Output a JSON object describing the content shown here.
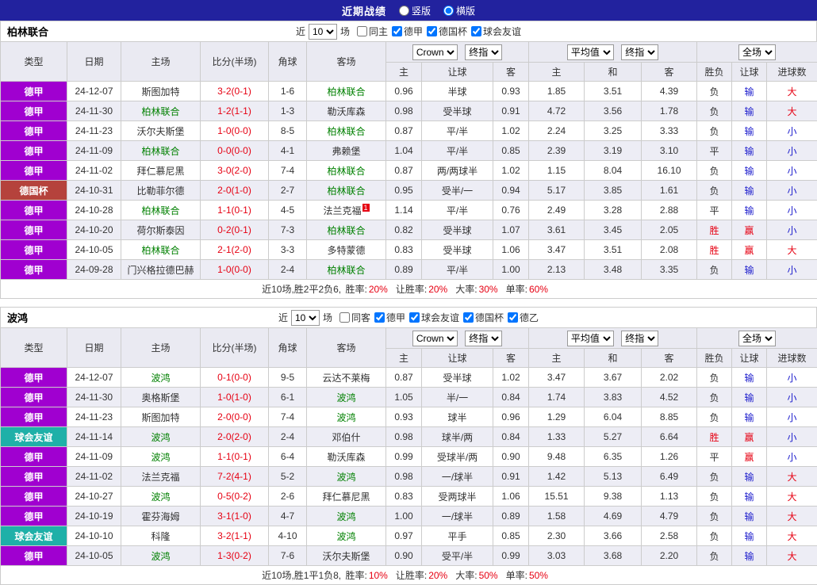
{
  "titlebar": {
    "title": "近期战绩",
    "options": [
      {
        "label": "竖版",
        "selected": false
      },
      {
        "label": "横版",
        "selected": true
      }
    ]
  },
  "columns": {
    "type": "类型",
    "date": "日期",
    "home": "主场",
    "score": "比分(半场)",
    "corner": "角球",
    "away": "客场",
    "asia_home": "主",
    "asia_handicap": "让球",
    "asia_away": "客",
    "euro_home": "主",
    "euro_draw": "和",
    "euro_away": "客",
    "result": "胜负",
    "handicap_result": "让球",
    "goals": "进球数"
  },
  "header_dropdowns": {
    "company": "Crown",
    "final1": "终指",
    "average": "平均值",
    "final2": "终指",
    "scope": "全场"
  },
  "league_colors": {
    "德甲": "#a000d0",
    "德国杯": "#b5423c",
    "球会友谊": "#1fb0a8"
  },
  "value_colors": {
    "胜": "#e60012",
    "平": "#333333",
    "负": "#333333",
    "赢": "#e60012",
    "输": "#1a1acc",
    "大": "#e60012",
    "小": "#1a1acc"
  },
  "sections": [
    {
      "team": "柏林联合",
      "filter": {
        "near_label": "近",
        "count": "10",
        "games_label": "场",
        "checkboxes": [
          {
            "label": "同主",
            "checked": false
          },
          {
            "label": "德甲",
            "checked": true
          },
          {
            "label": "德国杯",
            "checked": true
          },
          {
            "label": "球会友谊",
            "checked": true
          }
        ]
      },
      "rows": [
        {
          "league": "德甲",
          "date": "24-12-07",
          "home": "斯图加特",
          "score": "3-2(0-1)",
          "corner": "1-6",
          "away": "柏林联合",
          "o1": "0.96",
          "handicap": "半球",
          "o3": "0.93",
          "e1": "1.85",
          "e2": "3.51",
          "e3": "4.39",
          "result": "负",
          "hres": "输",
          "goals": "大"
        },
        {
          "league": "德甲",
          "date": "24-11-30",
          "home": "柏林联合",
          "score": "1-2(1-1)",
          "corner": "1-3",
          "away": "勒沃库森",
          "o1": "0.98",
          "handicap": "受半球",
          "o3": "0.91",
          "e1": "4.72",
          "e2": "3.56",
          "e3": "1.78",
          "result": "负",
          "hres": "输",
          "goals": "大"
        },
        {
          "league": "德甲",
          "date": "24-11-23",
          "home": "沃尔夫斯堡",
          "score": "1-0(0-0)",
          "corner": "8-5",
          "away": "柏林联合",
          "o1": "0.87",
          "handicap": "平/半",
          "o3": "1.02",
          "e1": "2.24",
          "e2": "3.25",
          "e3": "3.33",
          "result": "负",
          "hres": "输",
          "goals": "小"
        },
        {
          "league": "德甲",
          "date": "24-11-09",
          "home": "柏林联合",
          "score": "0-0(0-0)",
          "corner": "4-1",
          "away": "弗赖堡",
          "o1": "1.04",
          "handicap": "平/半",
          "o3": "0.85",
          "e1": "2.39",
          "e2": "3.19",
          "e3": "3.10",
          "result": "平",
          "hres": "输",
          "goals": "小"
        },
        {
          "league": "德甲",
          "date": "24-11-02",
          "home": "拜仁慕尼黑",
          "score": "3-0(2-0)",
          "corner": "7-4",
          "away": "柏林联合",
          "o1": "0.87",
          "handicap": "两/两球半",
          "o3": "1.02",
          "e1": "1.15",
          "e2": "8.04",
          "e3": "16.10",
          "result": "负",
          "hres": "输",
          "goals": "小"
        },
        {
          "league": "德国杯",
          "date": "24-10-31",
          "home": "比勒菲尔德",
          "score": "2-0(1-0)",
          "corner": "2-7",
          "away": "柏林联合",
          "o1": "0.95",
          "handicap": "受半/一",
          "o3": "0.94",
          "e1": "5.17",
          "e2": "3.85",
          "e3": "1.61",
          "result": "负",
          "hres": "输",
          "goals": "小"
        },
        {
          "league": "德甲",
          "date": "24-10-28",
          "home": "柏林联合",
          "score": "1-1(0-1)",
          "corner": "4-5",
          "away": "法兰克福",
          "away_sup": "1",
          "o1": "1.14",
          "handicap": "平/半",
          "o3": "0.76",
          "e1": "2.49",
          "e2": "3.28",
          "e3": "2.88",
          "result": "平",
          "hres": "输",
          "goals": "小"
        },
        {
          "league": "德甲",
          "date": "24-10-20",
          "home": "荷尔斯泰因",
          "score": "0-2(0-1)",
          "corner": "7-3",
          "away": "柏林联合",
          "o1": "0.82",
          "handicap": "受半球",
          "o3": "1.07",
          "e1": "3.61",
          "e2": "3.45",
          "e3": "2.05",
          "result": "胜",
          "hres": "赢",
          "goals": "小"
        },
        {
          "league": "德甲",
          "date": "24-10-05",
          "home": "柏林联合",
          "score": "2-1(2-0)",
          "corner": "3-3",
          "away": "多特蒙德",
          "o1": "0.83",
          "handicap": "受半球",
          "o3": "1.06",
          "e1": "3.47",
          "e2": "3.51",
          "e3": "2.08",
          "result": "胜",
          "hres": "赢",
          "goals": "大"
        },
        {
          "league": "德甲",
          "date": "24-09-28",
          "home": "门兴格拉德巴赫",
          "score": "1-0(0-0)",
          "corner": "2-4",
          "away": "柏林联合",
          "o1": "0.89",
          "handicap": "平/半",
          "o3": "1.00",
          "e1": "2.13",
          "e2": "3.48",
          "e3": "3.35",
          "result": "负",
          "hres": "输",
          "goals": "小"
        }
      ],
      "footer": {
        "prefix": "近10场,胜2平2负6,",
        "stats": [
          {
            "label": "胜率:",
            "value": "20%"
          },
          {
            "label": "让胜率:",
            "value": "20%"
          },
          {
            "label": "大率:",
            "value": "30%"
          },
          {
            "label": "单率:",
            "value": "60%"
          }
        ]
      }
    },
    {
      "team": "波鸿",
      "filter": {
        "near_label": "近",
        "count": "10",
        "games_label": "场",
        "checkboxes": [
          {
            "label": "同客",
            "checked": false
          },
          {
            "label": "德甲",
            "checked": true
          },
          {
            "label": "球会友谊",
            "checked": true
          },
          {
            "label": "德国杯",
            "checked": true
          },
          {
            "label": "德乙",
            "checked": true
          }
        ]
      },
      "rows": [
        {
          "league": "德甲",
          "date": "24-12-07",
          "home": "波鸿",
          "score": "0-1(0-0)",
          "corner": "9-5",
          "away": "云达不莱梅",
          "o1": "0.87",
          "handicap": "受半球",
          "o3": "1.02",
          "e1": "3.47",
          "e2": "3.67",
          "e3": "2.02",
          "result": "负",
          "hres": "输",
          "goals": "小"
        },
        {
          "league": "德甲",
          "date": "24-11-30",
          "home": "奥格斯堡",
          "score": "1-0(1-0)",
          "corner": "6-1",
          "away": "波鸿",
          "o1": "1.05",
          "handicap": "半/一",
          "o3": "0.84",
          "e1": "1.74",
          "e2": "3.83",
          "e3": "4.52",
          "result": "负",
          "hres": "输",
          "goals": "小"
        },
        {
          "league": "德甲",
          "date": "24-11-23",
          "home": "斯图加特",
          "score": "2-0(0-0)",
          "corner": "7-4",
          "away": "波鸿",
          "o1": "0.93",
          "handicap": "球半",
          "o3": "0.96",
          "e1": "1.29",
          "e2": "6.04",
          "e3": "8.85",
          "result": "负",
          "hres": "输",
          "goals": "小"
        },
        {
          "league": "球会友谊",
          "date": "24-11-14",
          "home": "波鸿",
          "score": "2-0(2-0)",
          "corner": "2-4",
          "away": "邓伯什",
          "o1": "0.98",
          "handicap": "球半/两",
          "o3": "0.84",
          "e1": "1.33",
          "e2": "5.27",
          "e3": "6.64",
          "result": "胜",
          "hres": "赢",
          "goals": "小"
        },
        {
          "league": "德甲",
          "date": "24-11-09",
          "home": "波鸿",
          "score": "1-1(0-1)",
          "corner": "6-4",
          "away": "勒沃库森",
          "o1": "0.99",
          "handicap": "受球半/两",
          "o3": "0.90",
          "e1": "9.48",
          "e2": "6.35",
          "e3": "1.26",
          "result": "平",
          "hres": "赢",
          "goals": "小"
        },
        {
          "league": "德甲",
          "date": "24-11-02",
          "home": "法兰克福",
          "score": "7-2(4-1)",
          "corner": "5-2",
          "away": "波鸿",
          "o1": "0.98",
          "handicap": "一/球半",
          "o3": "0.91",
          "e1": "1.42",
          "e2": "5.13",
          "e3": "6.49",
          "result": "负",
          "hres": "输",
          "goals": "大"
        },
        {
          "league": "德甲",
          "date": "24-10-27",
          "home": "波鸿",
          "score": "0-5(0-2)",
          "corner": "2-6",
          "away": "拜仁慕尼黑",
          "o1": "0.83",
          "handicap": "受两球半",
          "o3": "1.06",
          "e1": "15.51",
          "e2": "9.38",
          "e3": "1.13",
          "result": "负",
          "hres": "输",
          "goals": "大"
        },
        {
          "league": "德甲",
          "date": "24-10-19",
          "home": "霍芬海姆",
          "score": "3-1(1-0)",
          "corner": "4-7",
          "away": "波鸿",
          "o1": "1.00",
          "handicap": "一/球半",
          "o3": "0.89",
          "e1": "1.58",
          "e2": "4.69",
          "e3": "4.79",
          "result": "负",
          "hres": "输",
          "goals": "大"
        },
        {
          "league": "球会友谊",
          "date": "24-10-10",
          "home": "科隆",
          "score": "3-2(1-1)",
          "corner": "4-10",
          "away": "波鸿",
          "o1": "0.97",
          "handicap": "平手",
          "o3": "0.85",
          "e1": "2.30",
          "e2": "3.66",
          "e3": "2.58",
          "result": "负",
          "hres": "输",
          "goals": "大"
        },
        {
          "league": "德甲",
          "date": "24-10-05",
          "home": "波鸿",
          "score": "1-3(0-2)",
          "corner": "7-6",
          "away": "沃尔夫斯堡",
          "o1": "0.90",
          "handicap": "受平/半",
          "o3": "0.99",
          "e1": "3.03",
          "e2": "3.68",
          "e3": "2.20",
          "result": "负",
          "hres": "输",
          "goals": "大"
        }
      ],
      "footer": {
        "prefix": "近10场,胜1平1负8,",
        "stats": [
          {
            "label": "胜率:",
            "value": "10%"
          },
          {
            "label": "让胜率:",
            "value": "20%"
          },
          {
            "label": "大率:",
            "value": "50%"
          },
          {
            "label": "单率:",
            "value": "50%"
          }
        ]
      }
    }
  ]
}
